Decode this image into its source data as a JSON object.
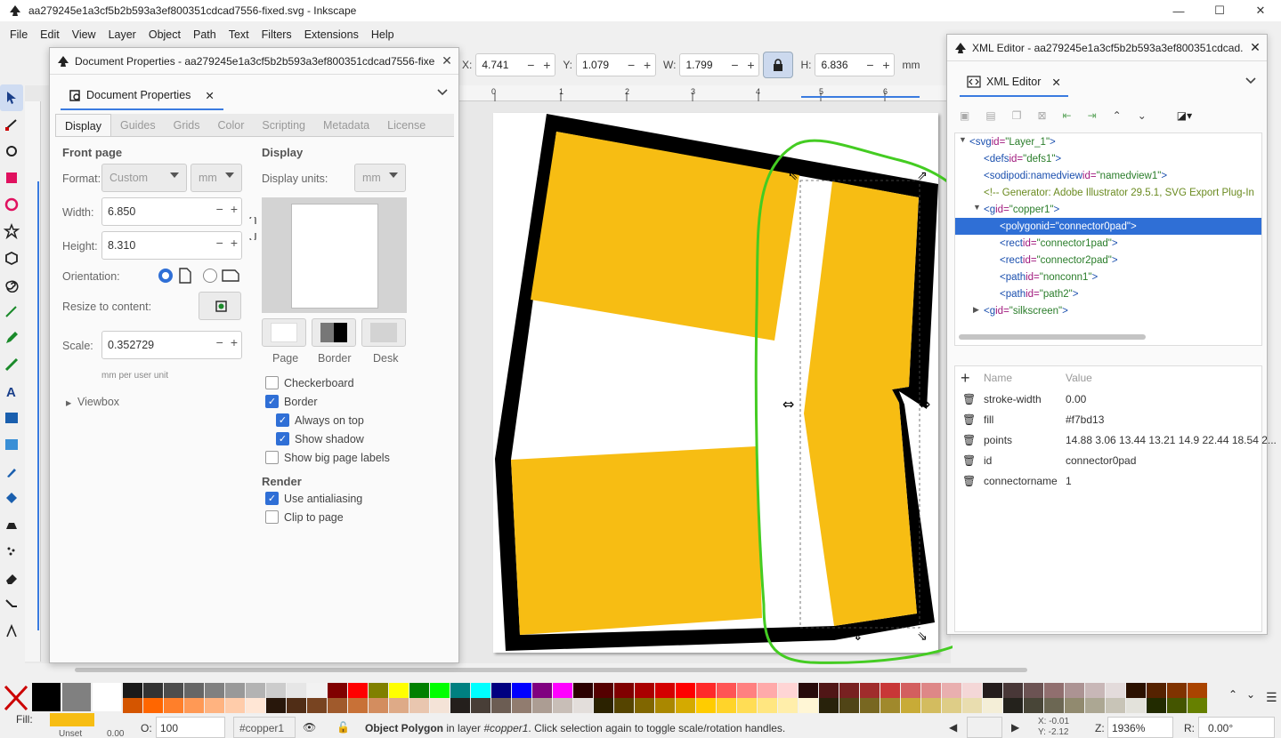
{
  "window": {
    "title": "aa279245e1a3cf5b2b593a3ef800351cdcad7556-fixed.svg - Inkscape"
  },
  "menu": [
    "File",
    "Edit",
    "View",
    "Layer",
    "Object",
    "Path",
    "Text",
    "Filters",
    "Extensions",
    "Help"
  ],
  "controls": {
    "x_label": "X:",
    "x": "4.741",
    "y_label": "Y:",
    "y": "1.079",
    "w_label": "W:",
    "w": "1.799",
    "h_label": "H:",
    "h": "6.836",
    "unit": "mm"
  },
  "docprops": {
    "title": "Document Properties - aa279245e1a3cf5b2b593a3ef800351cdcad7556-fixe...",
    "tab_label": "Document Properties",
    "subtabs": [
      "Display",
      "Guides",
      "Grids",
      "Color",
      "Scripting",
      "Metadata",
      "License"
    ],
    "front_page": "Front page",
    "format_label": "Format:",
    "format_value": "Custom",
    "format_unit": "mm",
    "width_label": "Width:",
    "width_value": "6.850",
    "height_label": "Height:",
    "height_value": "8.310",
    "orientation_label": "Orientation:",
    "resize_label": "Resize to content:",
    "scale_label": "Scale:",
    "scale_value": "0.352729",
    "scale_unit": "mm per user unit",
    "viewbox_label": "Viewbox",
    "display_header": "Display",
    "display_units_label": "Display units:",
    "display_units_value": "mm",
    "swatch_labels": [
      "Page",
      "Border",
      "Desk"
    ],
    "checkboxes": {
      "checkerboard": "Checkerboard",
      "border": "Border",
      "always_on_top": "Always on top",
      "show_shadow": "Show shadow",
      "big_labels": "Show big page labels"
    },
    "render_header": "Render",
    "antialias": "Use antialiasing",
    "clip": "Clip to page"
  },
  "xml": {
    "title": "XML Editor - aa279245e1a3cf5b2b593a3ef800351cdcad...",
    "tab_label": "XML Editor",
    "nodes": [
      {
        "tag": "<svg",
        "attr": " id=",
        "val": "\"Layer_1\"",
        "end": ">"
      },
      {
        "tag": "<defs",
        "attr": " id=",
        "val": "\"defs1\"",
        "end": ">"
      },
      {
        "tag": "<sodipodi:namedview",
        "attr": " id=",
        "val": "\"namedview1\"",
        "end": ">"
      },
      {
        "comment": "<!-- Generator: Adobe Illustrator 29.5.1, SVG Export Plug-In"
      },
      {
        "tag": "<g",
        "attr": " id=",
        "val": "\"copper1\"",
        "end": ">"
      },
      {
        "tag": "<polygon",
        "attr": " id=",
        "val": "\"connector0pad\"",
        "end": ">"
      },
      {
        "tag": "<rect",
        "attr": " id=",
        "val": "\"connector1pad\"",
        "end": ">"
      },
      {
        "tag": "<rect",
        "attr": " id=",
        "val": "\"connector2pad\"",
        "end": ">"
      },
      {
        "tag": "<path",
        "attr": " id=",
        "val": "\"nonconn1\"",
        "end": ">"
      },
      {
        "tag": "<path",
        "attr": " id=",
        "val": "\"path2\"",
        "end": ">"
      },
      {
        "tag": "<g",
        "attr": " id=",
        "val": "\"silkscreen\"",
        "end": ">"
      }
    ],
    "attr_header": {
      "name": "Name",
      "value": "Value"
    },
    "attributes": [
      {
        "name": "stroke-width",
        "value": "0.00"
      },
      {
        "name": "fill",
        "value": "#f7bd13"
      },
      {
        "name": "points",
        "value": "14.88 3.06 13.44 13.21 14.9 22.44 18.54 2..."
      },
      {
        "name": "id",
        "value": "connector0pad"
      },
      {
        "name": "connectorname",
        "value": "1"
      }
    ]
  },
  "status": {
    "fill_label": "Fill:",
    "stroke_value": "Unset",
    "stroke_width": "0.00",
    "opacity_label": "O:",
    "opacity": "100",
    "layer": "#copper1",
    "message_bold": "Object Polygon",
    "message_rest": " in layer ",
    "message_layer": "#copper1",
    "message_end": ". Click selection again to toggle scale/rotation handles.",
    "x": "X: -0.01",
    "y": "Y: -2.12",
    "zoom_label": "Z:",
    "zoom": "1936%",
    "rot_label": "R:",
    "rot": "0.00°"
  },
  "colors": {
    "accent": "#2f6fd6",
    "pad_fill": "#f7bd13",
    "annotation": "#44cc22"
  }
}
